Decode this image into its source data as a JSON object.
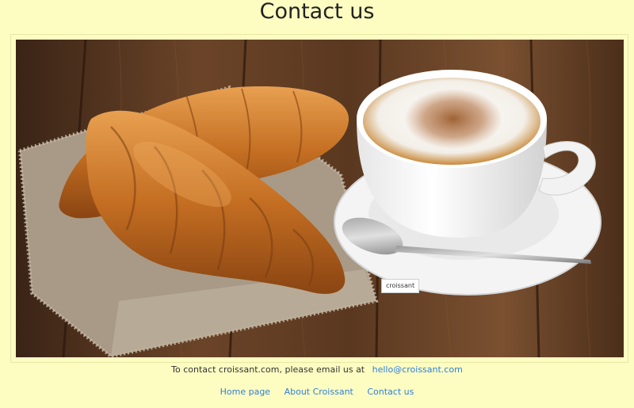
{
  "page": {
    "title": "Contact us"
  },
  "image": {
    "tooltip": "croissant"
  },
  "contact": {
    "text": "To contact croissant.com, please email us at",
    "email": "hello@croissant.com"
  },
  "nav": {
    "items": [
      {
        "label": "Home page"
      },
      {
        "label": "About Croissant"
      },
      {
        "label": "Contact us"
      }
    ]
  },
  "colors": {
    "background": "#fdfdc2",
    "link": "#2f7fd8",
    "text": "#333333"
  }
}
